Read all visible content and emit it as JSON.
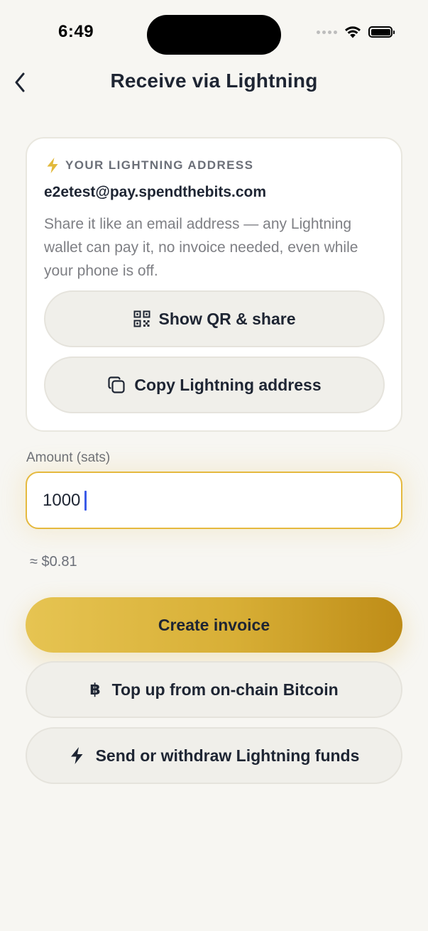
{
  "status_bar": {
    "time": "6:49"
  },
  "header": {
    "title": "Receive via Lightning",
    "back_icon": "chevron-left-icon"
  },
  "address_card": {
    "label": "YOUR LIGHTNING ADDRESS",
    "label_icon": "lightning-bolt-icon",
    "address": "e2etest@pay.spendthebits.com",
    "description": "Share it like an email address — any Lightning wallet can pay it, no invoice needed, even while your phone is off.",
    "qr_button_label": "Show QR & share",
    "qr_button_icon": "qr-code-icon",
    "copy_button_label": "Copy Lightning address",
    "copy_button_icon": "copy-icon"
  },
  "amount": {
    "label": "Amount (sats)",
    "value": "1000",
    "fiat_estimate": "≈ $0.81"
  },
  "actions": {
    "create_invoice_label": "Create invoice",
    "topup_label": "Top up from on-chain Bitcoin",
    "topup_icon_glyph": "฿",
    "send_label": "Send or withdraw Lightning funds",
    "send_icon": "lightning-bolt-icon"
  },
  "colors": {
    "background": "#F7F6F2",
    "accent_gold": "#D8AF36",
    "text_primary": "#1E2533",
    "text_secondary": "#7E7F84",
    "input_border": "#E5B93E",
    "caret": "#3B5BE8"
  }
}
